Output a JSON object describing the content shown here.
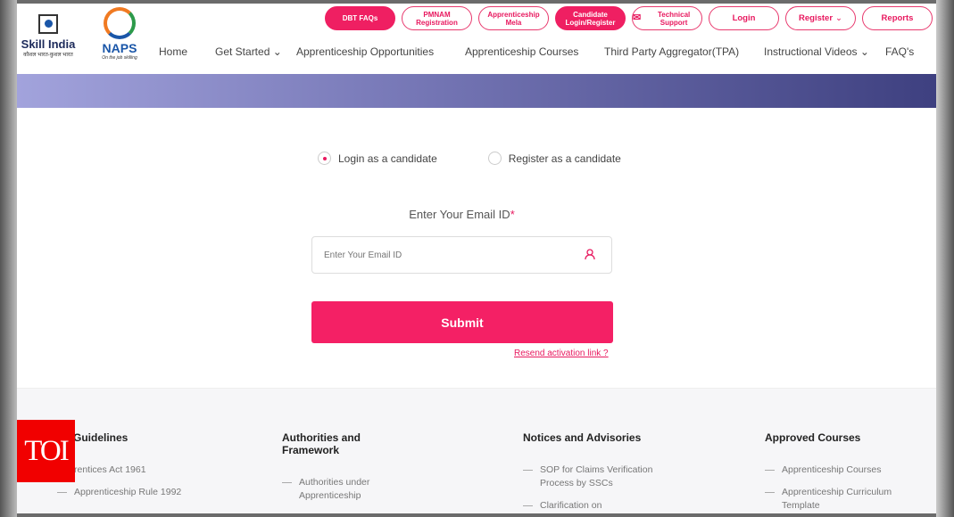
{
  "logos": {
    "skill_india": "Skill India",
    "skill_india_tagline": "कौशल भारत-कुशल भारत",
    "naps": "NAPS",
    "naps_tagline": "On the job skilling"
  },
  "top_buttons": [
    {
      "label": "DBT FAQs",
      "filled": true
    },
    {
      "label": "PMNAM Registration"
    },
    {
      "label": "Apprenticeship Mela"
    },
    {
      "label": "Candidate Login/Register",
      "filled": true
    },
    {
      "label": "Technical Support",
      "icon": "mail-icon"
    },
    {
      "label": "Login"
    },
    {
      "label": "Register",
      "dropdown": true
    },
    {
      "label": "Reports"
    }
  ],
  "nav": [
    "Home",
    "Get Started",
    "Apprenticeship Opportunities",
    "Apprenticeship Courses",
    "Third Party Aggregator(TPA)",
    "Instructional Videos",
    "FAQ's"
  ],
  "form": {
    "radio_login": "Login as a candidate",
    "radio_register": "Register as a candidate",
    "selected": "login",
    "email_label": "Enter Your Email ID",
    "required_mark": "*",
    "email_placeholder": "Enter Your Email ID",
    "submit": "Submit",
    "resend": "Resend activation link ?"
  },
  "footer": [
    {
      "title": "nd Guidelines",
      "items": [
        "rentices Act 1961",
        "Apprenticeship Rule 1992"
      ]
    },
    {
      "title": "Authorities and Framework",
      "items": [
        "Authorities under Apprenticeship"
      ]
    },
    {
      "title": "Notices and Advisories",
      "items": [
        "SOP for Claims Verification Process by SSCs",
        "Clarification on"
      ]
    },
    {
      "title": "Approved Courses",
      "items": [
        "Apprenticeship Courses",
        "Apprenticeship Curriculum Template"
      ]
    }
  ],
  "watermark": "TOI",
  "colors": {
    "accent": "#ef1f62",
    "banner_start": "#a2a3dc",
    "banner_end": "#3e4080"
  }
}
